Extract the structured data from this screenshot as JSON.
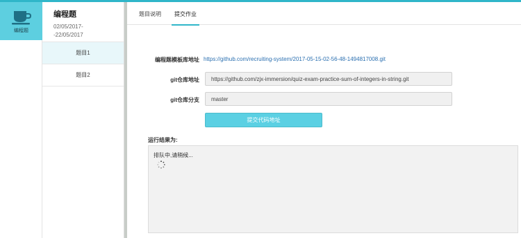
{
  "rail": {
    "icon": "coffee-cup-icon",
    "label": "编程题",
    "accent": "#5dcfe0"
  },
  "assignment": {
    "title": "编程题",
    "dates": "02/05/2017-\n-22/05/2017"
  },
  "questions": [
    {
      "label": "题目1"
    },
    {
      "label": "题目2"
    }
  ],
  "tabs": [
    {
      "label": "题目说明"
    },
    {
      "label": "提交作业"
    }
  ],
  "form": {
    "template_label": "编程题模板库地址",
    "template_url": "https://github.com/recruiting-system/2017-05-15-02-56-48-1494817008.git",
    "repo_label": "git仓库地址",
    "repo_value": "https://github.com/zjx-immersion/quiz-exam-practice-sum-of-integers-in-string.git",
    "branch_label": "git仓库分支",
    "branch_value": "master",
    "submit_label": "提交代码地址"
  },
  "result": {
    "label": "运行结果为:",
    "status": "排队中,请稍候..."
  }
}
